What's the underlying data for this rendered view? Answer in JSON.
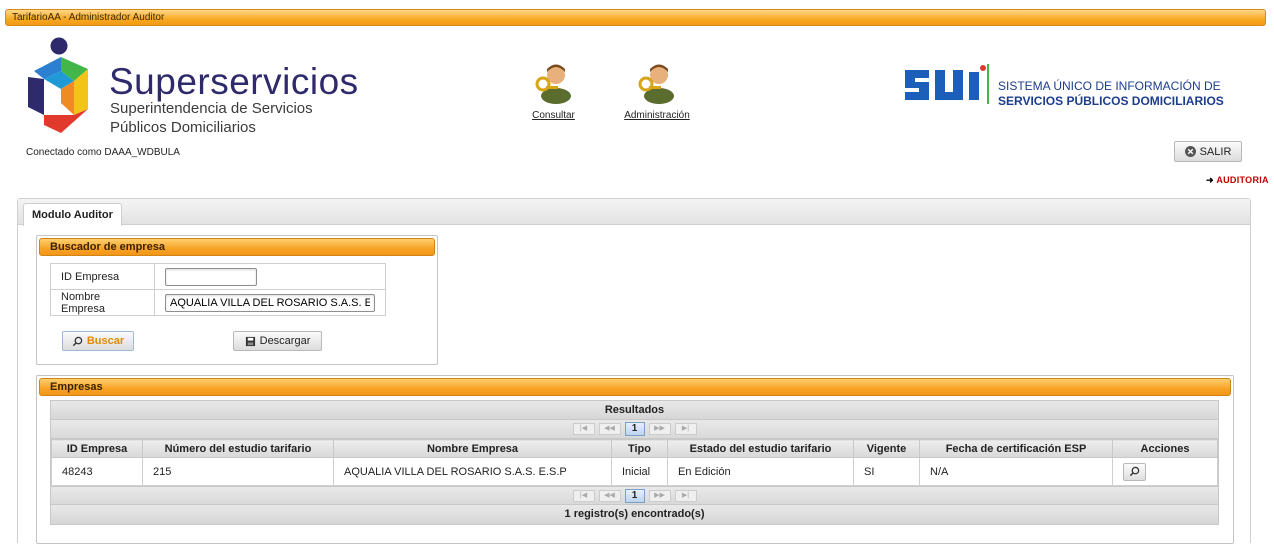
{
  "window": {
    "title": "TarifarioAA - Administrador Auditor"
  },
  "header": {
    "logo": {
      "brand": "Superservicios",
      "line1": "Superintendencia de Servicios",
      "line2": "Públicos Domiciliarios"
    },
    "nav": [
      {
        "label": "Consultar",
        "icon": "user-key-icon"
      },
      {
        "label": "Administración",
        "icon": "user-key-icon"
      }
    ],
    "sui": {
      "line1": "SISTEMA ÚNICO DE INFORMACIÓN DE",
      "line2": "SERVICIOS PÚBLICOS DOMICILIARIOS"
    },
    "connected_as": "Conectado como DAAA_WDBULA",
    "logout_label": "SALIR",
    "auditoria_link": "AUDITORIA"
  },
  "tabs": [
    {
      "label": "Modulo Auditor",
      "active": true
    }
  ],
  "search_panel": {
    "title": "Buscador de empresa",
    "fields": [
      {
        "label": "ID Empresa",
        "value": ""
      },
      {
        "label": "Nombre Empresa",
        "value": "AQUALIA VILLA DEL ROSARIO S.A.S. E"
      }
    ],
    "search_label": "Buscar",
    "download_label": "Descargar"
  },
  "results_panel": {
    "title": "Empresas",
    "grid_title": "Resultados",
    "current_page": "1",
    "columns": [
      "ID Empresa",
      "Número del estudio tarifario",
      "Nombre Empresa",
      "Tipo",
      "Estado del estudio tarifario",
      "Vigente",
      "Fecha de certificación ESP",
      "Acciones"
    ],
    "rows": [
      [
        "48243",
        "215",
        "AQUALIA VILLA DEL ROSARIO S.A.S. E.S.P",
        "Inicial",
        "En Edición",
        "SI",
        "N/A"
      ]
    ],
    "footer": "1 registro(s) encontrado(s)"
  },
  "colors": {
    "accent_orange": "#f7a325",
    "brand_blue": "#2e2a6b",
    "sui_blue": "#1c3d8c",
    "link_red": "#c00000"
  }
}
